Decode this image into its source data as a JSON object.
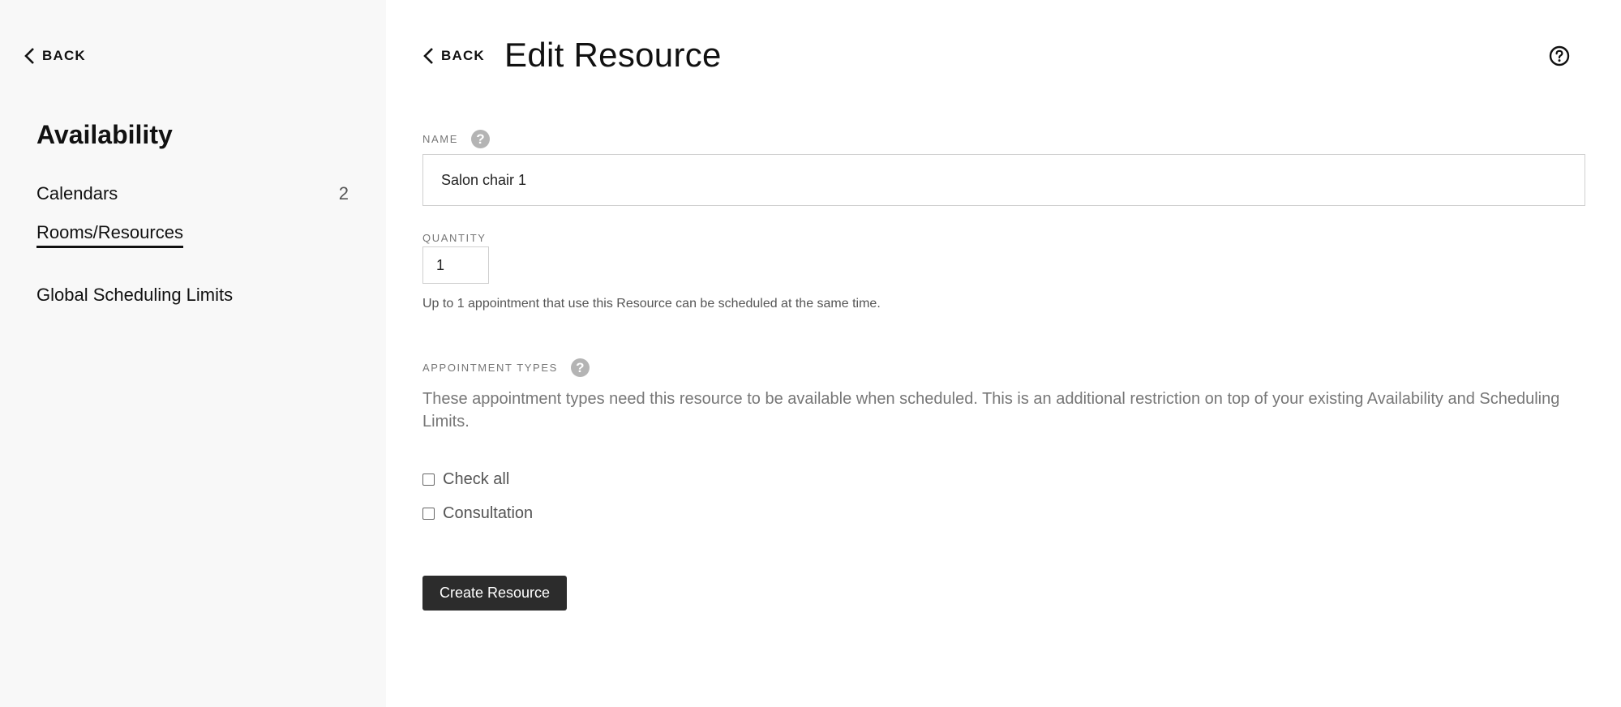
{
  "sidebar": {
    "back_label": "BACK",
    "title": "Availability",
    "items": [
      {
        "label": "Calendars",
        "count": "2"
      },
      {
        "label": "Rooms/Resources",
        "active": true
      },
      {
        "label": "Global Scheduling Limits"
      }
    ]
  },
  "main": {
    "back_label": "BACK",
    "title": "Edit Resource",
    "name_field": {
      "label": "NAME",
      "value": "Salon chair 1"
    },
    "quantity_field": {
      "label": "QUANTITY",
      "value": "1",
      "helper": "Up to 1 appointment that use this Resource can be scheduled at the same time."
    },
    "appointment_types": {
      "label": "APPOINTMENT TYPES",
      "description": "These appointment types need this resource to be available when scheduled. This is an additional restriction on top of your existing Availability and Scheduling Limits.",
      "options": [
        {
          "label": "Check all",
          "checked": false
        },
        {
          "label": "Consultation",
          "checked": false
        }
      ]
    },
    "submit_label": "Create Resource"
  },
  "icons": {
    "back": "chevron-left-icon",
    "help": "question-circle-icon",
    "field_help": "question-mark-icon"
  },
  "colors": {
    "sidebar_bg": "#f8f8f8",
    "primary_button": "#2c2c2c",
    "help_badge": "#b4b4b4"
  }
}
